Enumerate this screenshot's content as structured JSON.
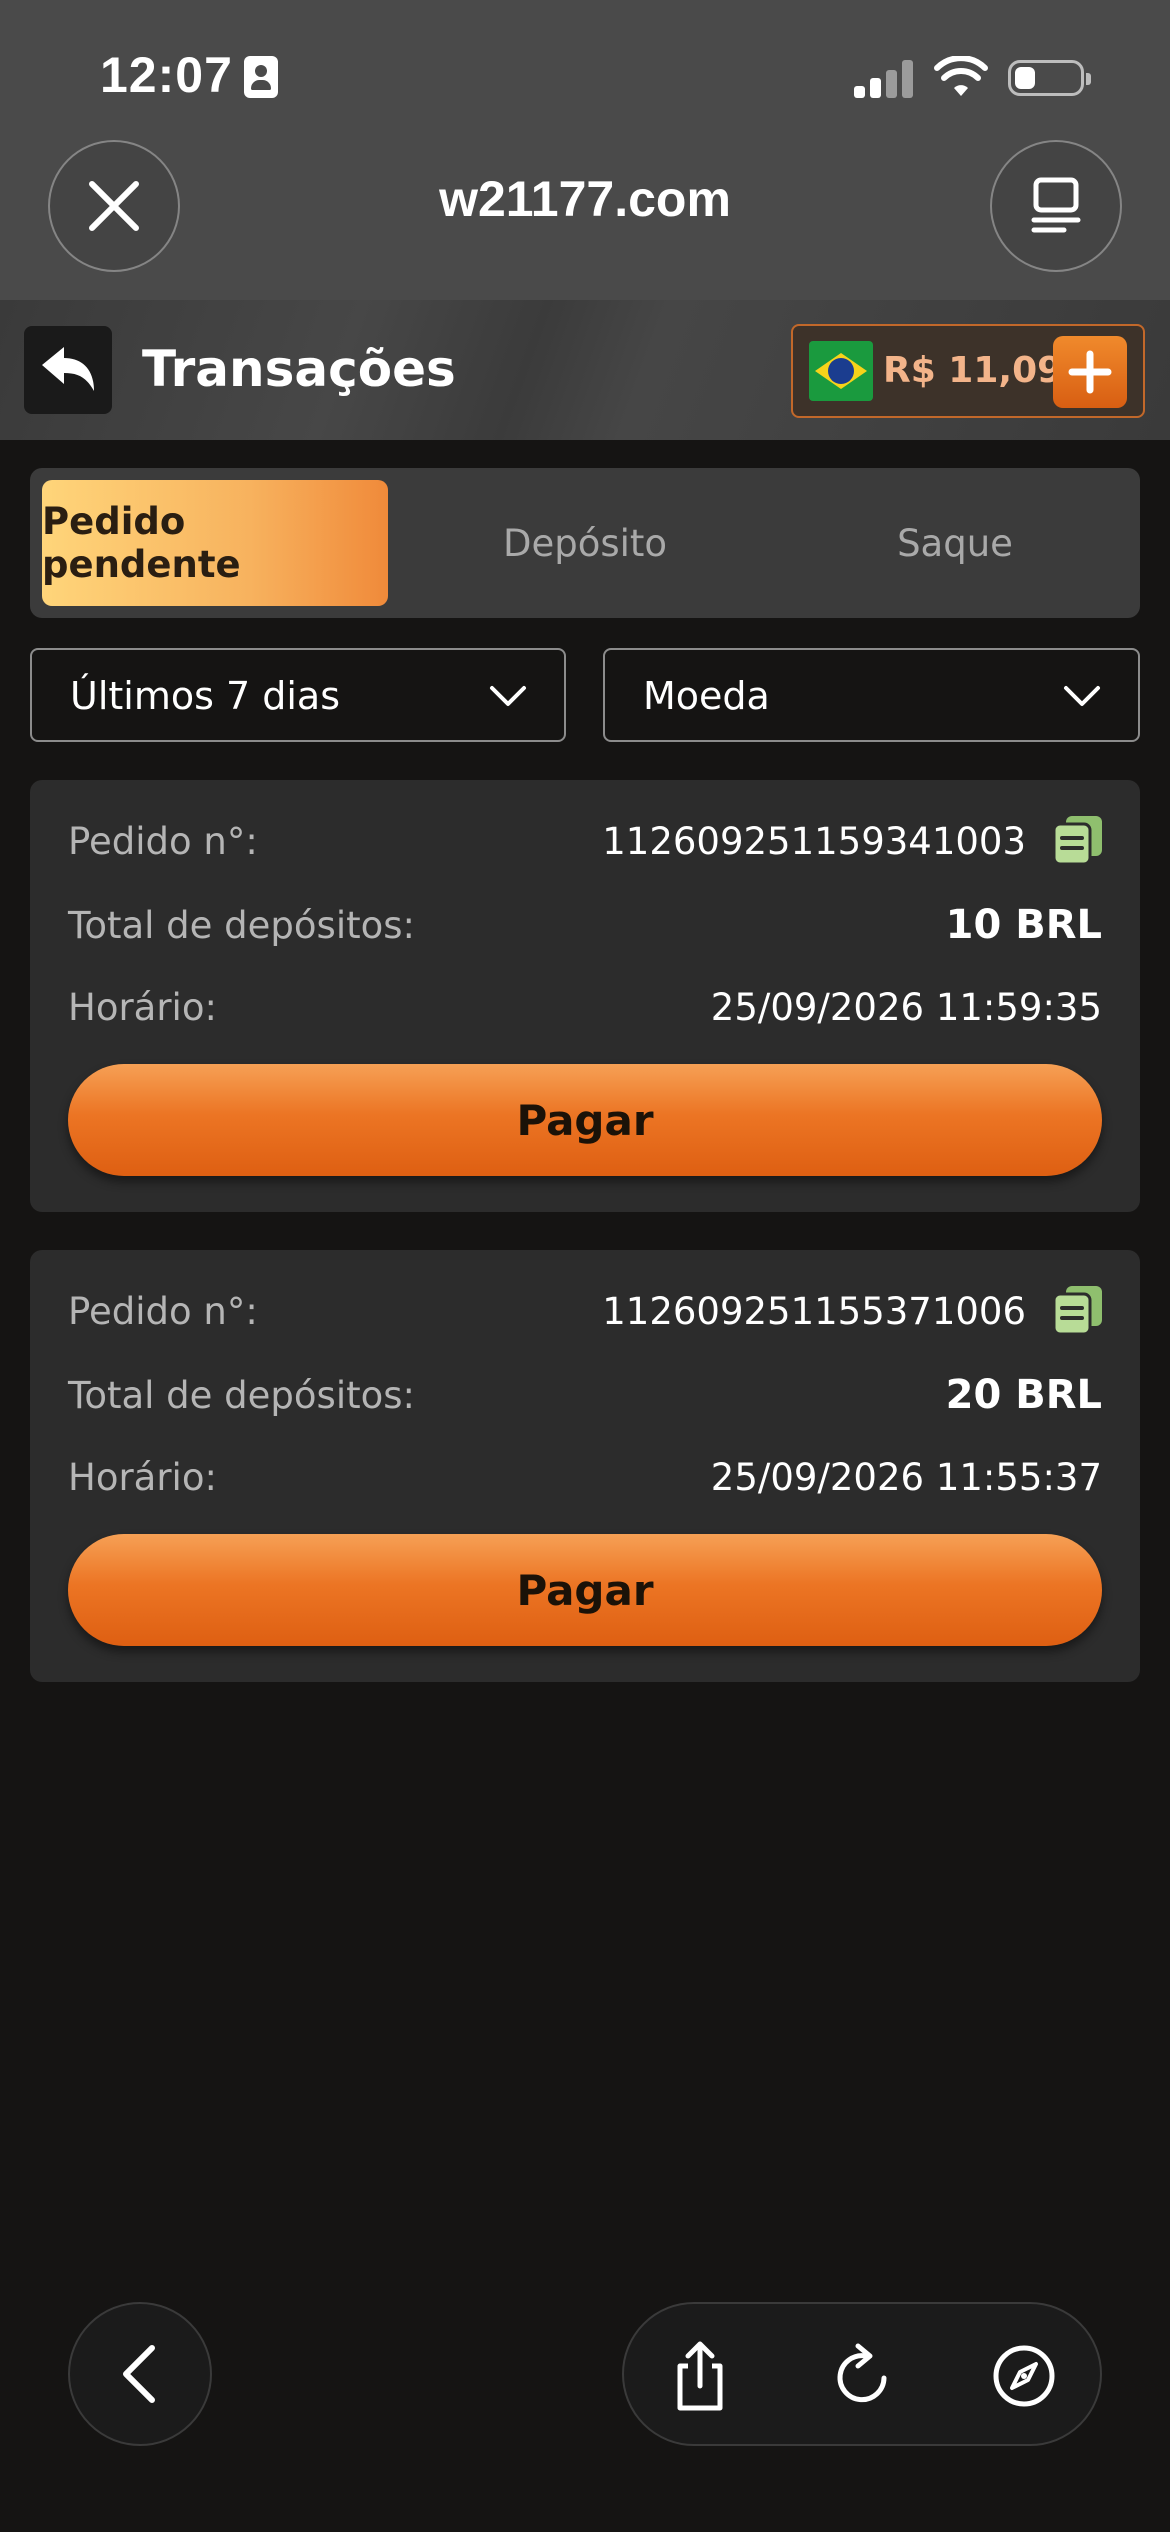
{
  "status_bar": {
    "time": "12:07"
  },
  "browser": {
    "url": "w21177.com"
  },
  "header": {
    "title": "Transações",
    "balance": "R$ 11,09",
    "accent_color": "#e8721e"
  },
  "tabs": [
    {
      "label": "Pedido pendente",
      "active": true
    },
    {
      "label": "Depósito",
      "active": false
    },
    {
      "label": "Saque",
      "active": false
    }
  ],
  "filters": {
    "period": "Últimos 7 dias",
    "currency": "Moeda"
  },
  "orders": [
    {
      "order_label": "Pedido n°:",
      "order_id": "112609251159341003",
      "total_label": "Total de depósitos:",
      "total": "10 BRL",
      "time_label": "Horário:",
      "time": "25/09/2026 11:59:35",
      "pay_label": "Pagar"
    },
    {
      "order_label": "Pedido n°:",
      "order_id": "112609251155371006",
      "total_label": "Total de depósitos:",
      "total": "20 BRL",
      "time_label": "Horário:",
      "time": "25/09/2026 11:55:37",
      "pay_label": "Pagar"
    }
  ]
}
